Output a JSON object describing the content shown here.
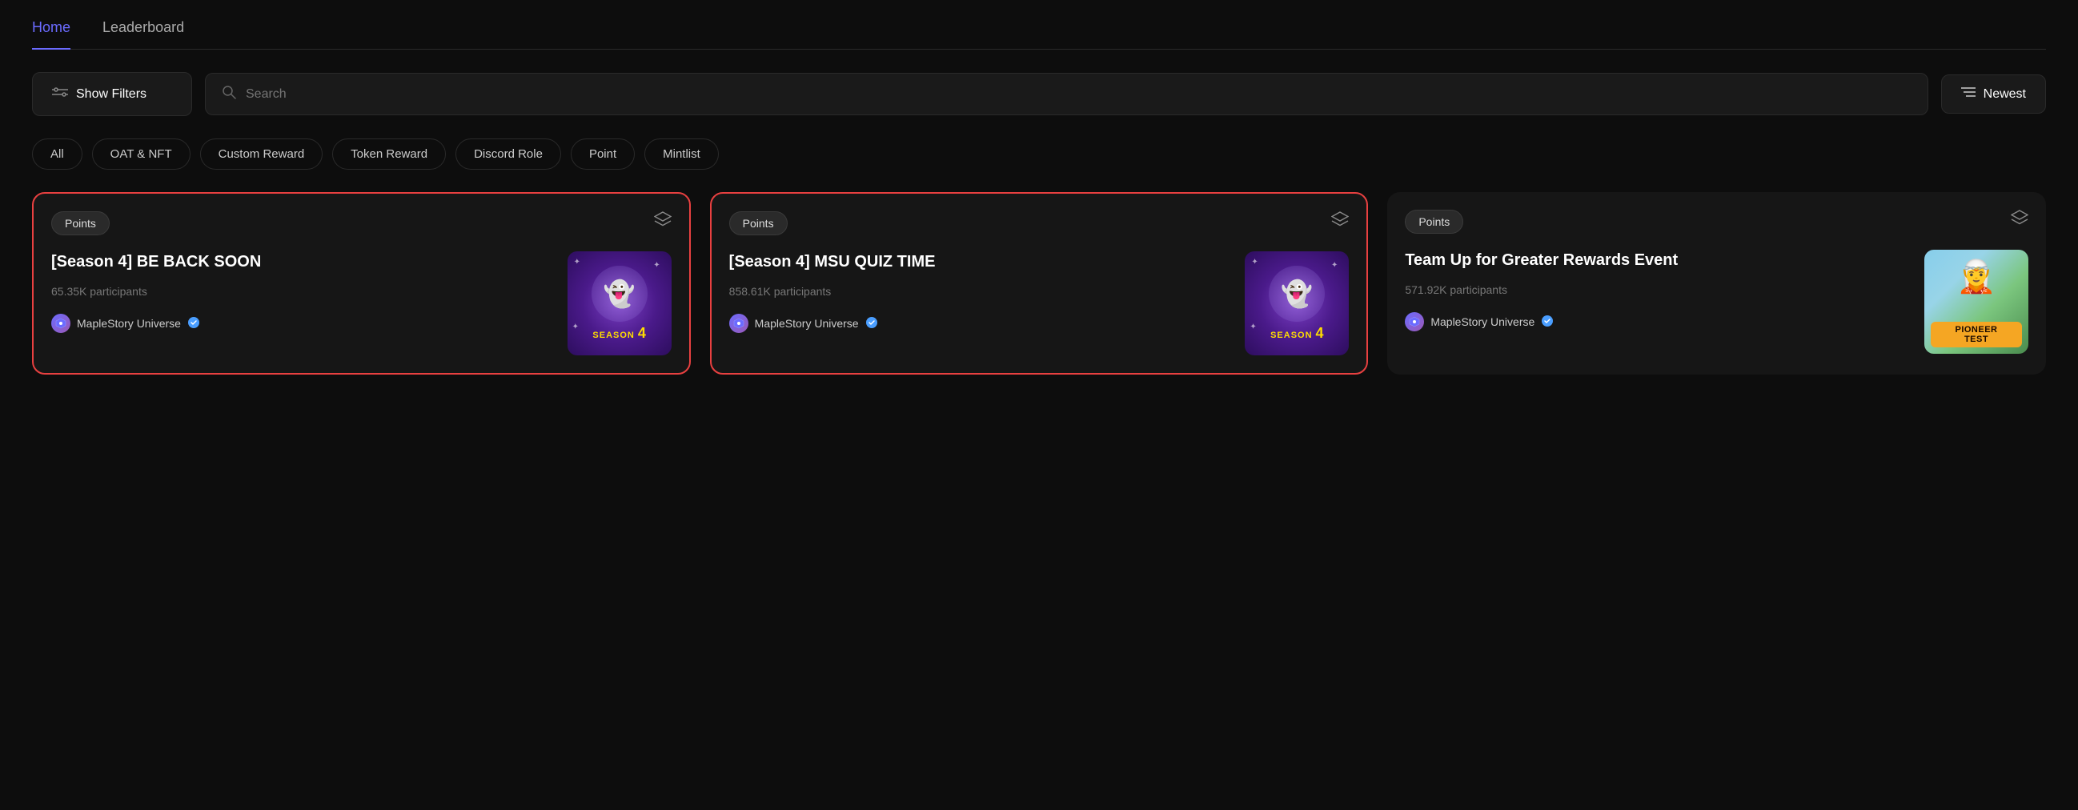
{
  "nav": {
    "tabs": [
      {
        "id": "home",
        "label": "Home",
        "active": true
      },
      {
        "id": "leaderboard",
        "label": "Leaderboard",
        "active": false
      }
    ]
  },
  "toolbar": {
    "filter_label": "Show Filters",
    "search_placeholder": "Search",
    "sort_label": "Newest"
  },
  "filter_pills": [
    {
      "id": "all",
      "label": "All"
    },
    {
      "id": "oat-nft",
      "label": "OAT & NFT"
    },
    {
      "id": "custom-reward",
      "label": "Custom Reward"
    },
    {
      "id": "token-reward",
      "label": "Token Reward"
    },
    {
      "id": "discord-role",
      "label": "Discord Role"
    },
    {
      "id": "point",
      "label": "Point"
    },
    {
      "id": "mintlist",
      "label": "Mintlist"
    }
  ],
  "cards": [
    {
      "id": "card-1",
      "highlighted": true,
      "badge": "Points",
      "title": "[Season 4] BE BACK SOON",
      "participants": "65.35K participants",
      "project": "MapleStory Universe",
      "verified": true,
      "image_type": "season4"
    },
    {
      "id": "card-2",
      "highlighted": true,
      "badge": "Points",
      "title": "[Season 4] MSU QUIZ TIME",
      "participants": "858.61K participants",
      "project": "MapleStory Universe",
      "verified": true,
      "image_type": "season4"
    },
    {
      "id": "card-3",
      "highlighted": false,
      "badge": "Points",
      "title": "Team Up for Greater Rewards Event",
      "participants": "571.92K participants",
      "project": "MapleStory Universe",
      "verified": true,
      "image_type": "pioneer"
    }
  ],
  "icons": {
    "filter": "⚙",
    "search": "🔍",
    "sort": "≡",
    "layers": "◈",
    "verified": "✓",
    "star": "✦"
  },
  "colors": {
    "accent": "#6b6bff",
    "highlight_border": "#e84040",
    "bg": "#0d0d0d",
    "card_bg": "#161616"
  }
}
